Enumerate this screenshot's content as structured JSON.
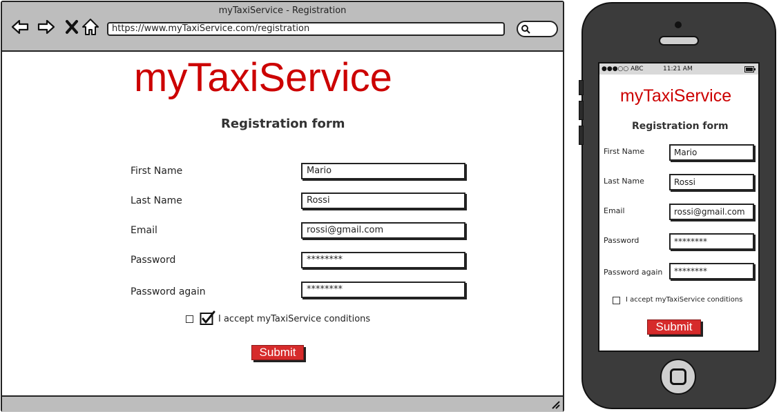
{
  "browser": {
    "title": "myTaxiService - Registration",
    "url": "https://www.myTaxiService.com/registration",
    "nav_icons": [
      "back-arrow-icon",
      "forward-arrow-icon",
      "stop-icon",
      "home-icon"
    ]
  },
  "page": {
    "brand": "myTaxiService",
    "heading": "Registration form",
    "fields": [
      {
        "label": "First Name",
        "value": "Mario"
      },
      {
        "label": "Last Name",
        "value": "Rossi"
      },
      {
        "label": "Email",
        "value": "rossi@gmail.com"
      },
      {
        "label": "Password",
        "value": "********"
      },
      {
        "label": "Password again",
        "value": "********"
      }
    ],
    "accept_label": "I accept myTaxiService conditions",
    "submit_label": "Submit"
  },
  "phone": {
    "status_carrier": "●●●○○ ABC",
    "status_time": "11:21 AM"
  },
  "colors": {
    "brand": "#cc0000",
    "submit": "#d62b2b",
    "chrome": "#bdbdbd",
    "phone_body": "#3b3b3b"
  }
}
